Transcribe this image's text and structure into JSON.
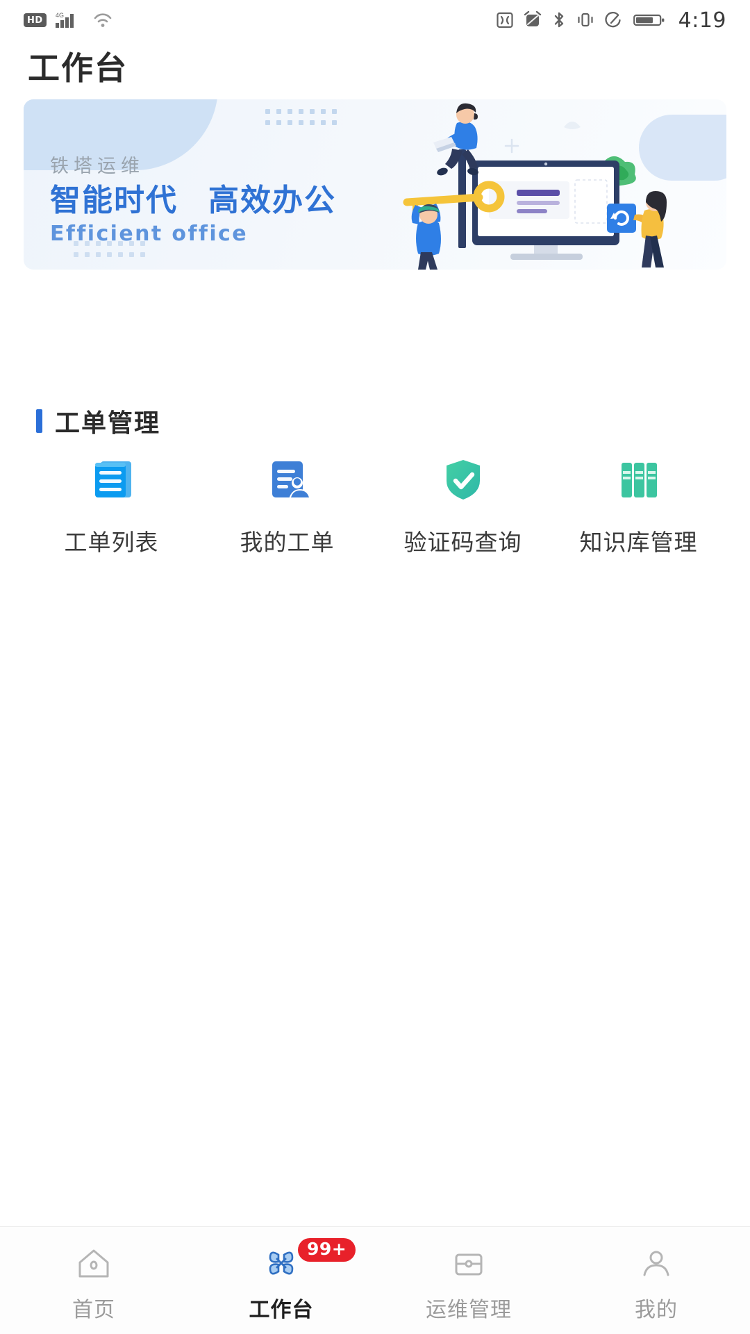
{
  "status_bar": {
    "hd_label": "HD",
    "time": "4:19",
    "left_icons": [
      "hd-badge-icon",
      "cellular-signal-icon",
      "wifi-icon"
    ],
    "right_icons": [
      "nfc-icon",
      "alarm-icon",
      "bluetooth-icon",
      "vibrate-icon",
      "do-not-disturb-icon",
      "battery-icon"
    ]
  },
  "header": {
    "title": "工作台"
  },
  "banner": {
    "eyebrow": "铁塔运维",
    "headline_left": "智能时代",
    "headline_right": "高效办公",
    "subtitle": "Efficient office",
    "illustration_name": "office-teamwork-illustration"
  },
  "section": {
    "title": "工单管理",
    "accent_color": "#2b6fd8"
  },
  "apps": [
    {
      "label": "工单列表",
      "icon": "document-list-icon",
      "color": "#1b9cf0"
    },
    {
      "label": "我的工单",
      "icon": "document-person-icon",
      "color": "#3e7fd6"
    },
    {
      "label": "验证码查询",
      "icon": "shield-check-icon",
      "color": "#38c1a3"
    },
    {
      "label": "知识库管理",
      "icon": "books-shelf-icon",
      "color": "#3cc5a0"
    }
  ],
  "tabbar": {
    "items": [
      {
        "label": "首页",
        "icon": "home-icon",
        "active": false,
        "badge": ""
      },
      {
        "label": "工作台",
        "icon": "workbench-icon",
        "active": true,
        "badge": "99+"
      },
      {
        "label": "运维管理",
        "icon": "toolbox-icon",
        "active": false,
        "badge": ""
      },
      {
        "label": "我的",
        "icon": "person-icon",
        "active": false,
        "badge": ""
      }
    ]
  }
}
